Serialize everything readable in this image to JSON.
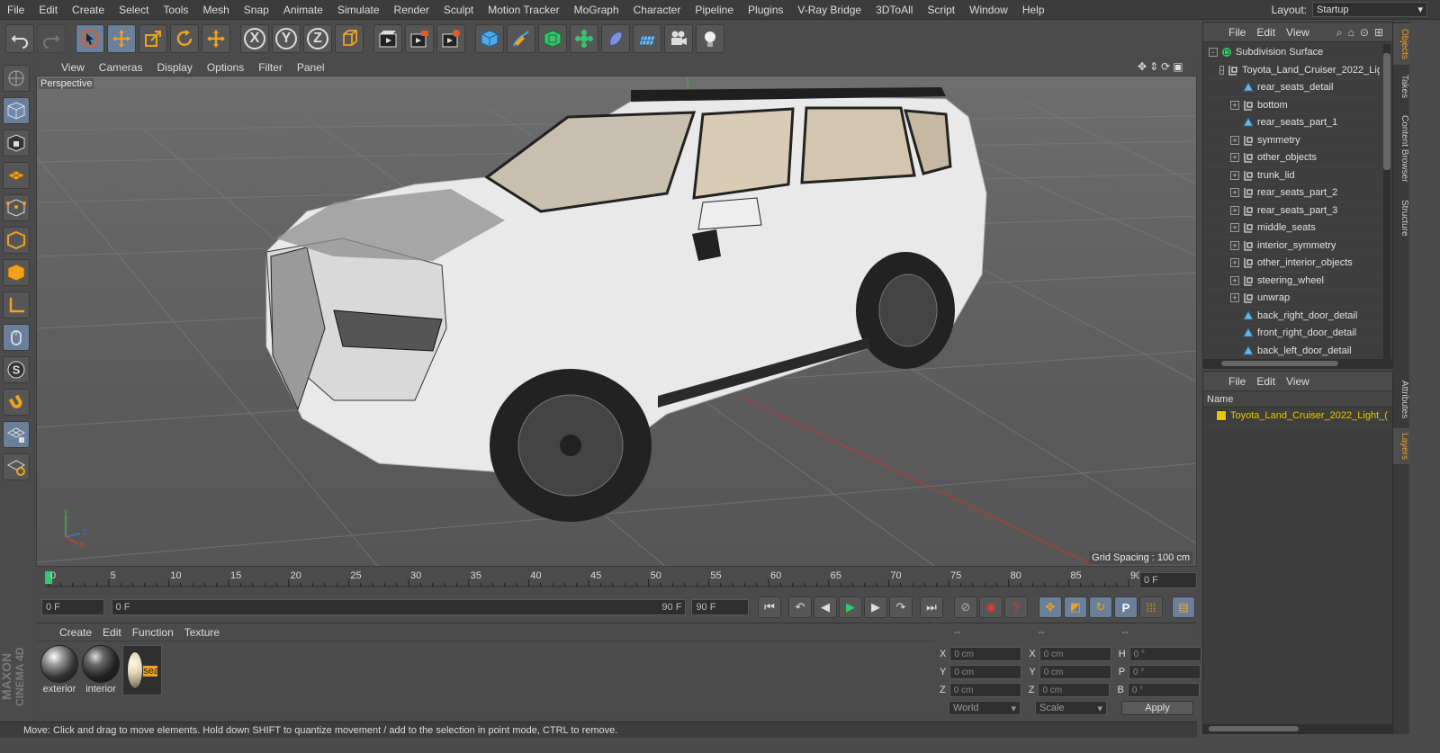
{
  "menubar": {
    "items": [
      "File",
      "Edit",
      "Create",
      "Select",
      "Tools",
      "Mesh",
      "Snap",
      "Animate",
      "Simulate",
      "Render",
      "Sculpt",
      "Motion Tracker",
      "MoGraph",
      "Character",
      "Pipeline",
      "Plugins",
      "V-Ray Bridge",
      "3DToAll",
      "Script",
      "Window",
      "Help"
    ],
    "layout_label": "Layout:",
    "layout_value": "Startup"
  },
  "toolbar": {
    "icons": [
      "undo-icon",
      "redo-icon",
      "select-arrow-icon",
      "move-icon",
      "scale-icon",
      "rotate-icon",
      "move-axis-icon",
      "x-axis-icon",
      "y-axis-icon",
      "z-axis-icon",
      "coordinate-system-icon",
      "render-view-icon",
      "render-picture-viewer-icon",
      "edit-render-settings-icon",
      "cube-icon",
      "pen-icon",
      "subdivision-icon",
      "cloner-icon",
      "deformer-icon",
      "floor-icon",
      "camera-icon",
      "light-icon"
    ],
    "axis_labels": [
      "X",
      "Y",
      "Z"
    ]
  },
  "viewport": {
    "menu": [
      "View",
      "Cameras",
      "Display",
      "Options",
      "Filter",
      "Panel"
    ],
    "label": "Perspective",
    "grid_spacing": "Grid Spacing : 100 cm",
    "gizmo": {
      "y": "Y",
      "z": "Z",
      "x": "X"
    }
  },
  "timeline": {
    "ticks": [
      "0",
      "5",
      "10",
      "15",
      "20",
      "25",
      "30",
      "35",
      "40",
      "45",
      "50",
      "55",
      "60",
      "65",
      "70",
      "75",
      "80",
      "85",
      "90"
    ],
    "current_frame_field": "0 F",
    "start_field": "0 F",
    "slider_start": "0 F",
    "slider_end": "90 F",
    "end_field": "90 F"
  },
  "materials": {
    "menu": [
      "Create",
      "Edit",
      "Function",
      "Texture"
    ],
    "items": [
      {
        "label": "exterior",
        "selected": false
      },
      {
        "label": "interior",
        "selected": false
      },
      {
        "label": "seats_1",
        "selected": true
      }
    ]
  },
  "coordinates": {
    "header": [
      "--",
      "--",
      "--"
    ],
    "rows": [
      {
        "a": "X",
        "av": "0 cm",
        "b": "X",
        "bv": "0 cm",
        "c": "H",
        "cv": "0 °"
      },
      {
        "a": "Y",
        "av": "0 cm",
        "b": "Y",
        "bv": "0 cm",
        "c": "P",
        "cv": "0 °"
      },
      {
        "a": "Z",
        "av": "0 cm",
        "b": "Z",
        "bv": "0 cm",
        "c": "B",
        "cv": "0 °"
      }
    ],
    "space": "World",
    "mode": "Scale",
    "apply": "Apply"
  },
  "status": "Move: Click and drag to move elements. Hold down SHIFT to quantize movement / add to the selection in point mode, CTRL to remove.",
  "brand": {
    "maxon": "MAXON",
    "product": "CINEMA 4D"
  },
  "objects": {
    "menu": [
      "File",
      "Edit",
      "View"
    ],
    "tree": [
      {
        "label": "Subdivision Surface",
        "indent": 0,
        "icon": "subdivision-surface-icon",
        "exp": "-"
      },
      {
        "label": "Toyota_Land_Cruiser_2022_Lig",
        "indent": 1,
        "icon": "null-object-icon",
        "exp": "-"
      },
      {
        "label": "rear_seats_detail",
        "indent": 2,
        "icon": "polygon-object-icon",
        "exp": ""
      },
      {
        "label": "bottom",
        "indent": 2,
        "icon": "null-object-icon",
        "exp": "+"
      },
      {
        "label": "rear_seats_part_1",
        "indent": 2,
        "icon": "polygon-object-icon",
        "exp": ""
      },
      {
        "label": "symmetry",
        "indent": 2,
        "icon": "null-object-icon",
        "exp": "+"
      },
      {
        "label": "other_objects",
        "indent": 2,
        "icon": "null-object-icon",
        "exp": "+"
      },
      {
        "label": "trunk_lid",
        "indent": 2,
        "icon": "null-object-icon",
        "exp": "+"
      },
      {
        "label": "rear_seats_part_2",
        "indent": 2,
        "icon": "null-object-icon",
        "exp": "+"
      },
      {
        "label": "rear_seats_part_3",
        "indent": 2,
        "icon": "null-object-icon",
        "exp": "+"
      },
      {
        "label": "middle_seats",
        "indent": 2,
        "icon": "null-object-icon",
        "exp": "+"
      },
      {
        "label": "interior_symmetry",
        "indent": 2,
        "icon": "null-object-icon",
        "exp": "+"
      },
      {
        "label": "other_interior_objects",
        "indent": 2,
        "icon": "null-object-icon",
        "exp": "+"
      },
      {
        "label": "steering_wheel",
        "indent": 2,
        "icon": "null-object-icon",
        "exp": "+"
      },
      {
        "label": "unwrap",
        "indent": 2,
        "icon": "null-object-icon",
        "exp": "+"
      },
      {
        "label": "back_right_door_detail",
        "indent": 2,
        "icon": "polygon-object-icon",
        "exp": ""
      },
      {
        "label": "front_right_door_detail",
        "indent": 2,
        "icon": "polygon-object-icon",
        "exp": ""
      },
      {
        "label": "back_left_door_detail",
        "indent": 2,
        "icon": "polygon-object-icon",
        "exp": ""
      }
    ]
  },
  "layers": {
    "menu": [
      "File",
      "Edit",
      "View"
    ],
    "column": "Name",
    "items": [
      {
        "label": "Toyota_Land_Cruiser_2022_Light_(",
        "color": "#e6c800"
      }
    ]
  },
  "side_tabs": [
    "Objects",
    "Takes",
    "Content Browser",
    "Structure",
    "Attributes",
    "Layers"
  ],
  "colors": {
    "accent": "#f0a21f",
    "active_button": "#6a7f9a",
    "panel": "#4b4b4b"
  }
}
